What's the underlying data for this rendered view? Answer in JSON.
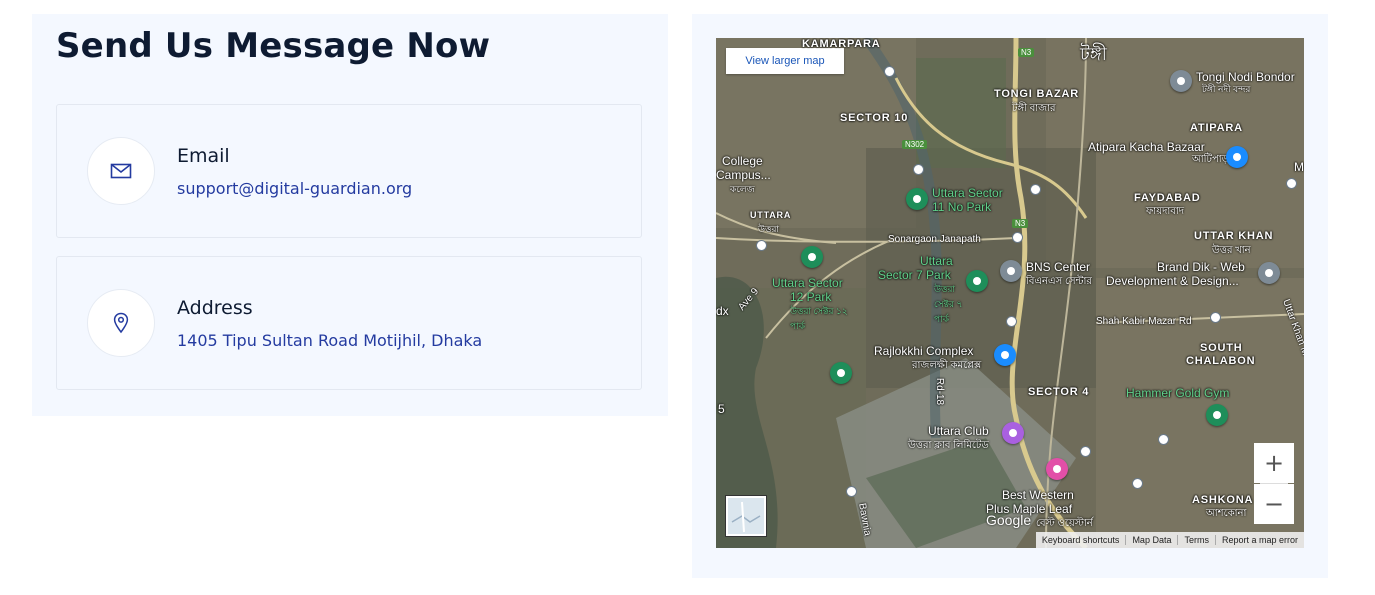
{
  "contact": {
    "heading": "Send Us Message Now",
    "email": {
      "title": "Email",
      "value": "support@digital-guardian.org",
      "icon": "envelope-icon"
    },
    "address": {
      "title": "Address",
      "value": "1405 Tipu Sultan Road Motijhil, Dhaka",
      "icon": "location-pin-icon"
    }
  },
  "map": {
    "view_larger": "View larger map",
    "zoom_in": "+",
    "zoom_out": "−",
    "google": "Google",
    "footer": {
      "shortcuts": "Keyboard shortcuts",
      "map_data": "Map Data",
      "terms": "Terms",
      "report": "Report a map error"
    },
    "labels": {
      "kamarpara": "KAMARPARA",
      "tongi_bn": "টঙ্গী",
      "tongi_nodi": "Tongi Nodi Bondor",
      "tongi_nodi_bn": "টঙ্গী নদী বন্দর",
      "tongi_bazar": "TONGI BAZAR",
      "tongi_bazar_bn": "টঙ্গী বাজার",
      "sector10": "SECTOR 10",
      "atipara": "ATIPARA",
      "atipara_kacha": "Atipara Kacha Bazaar",
      "atipara_kacha_bn": "আটিপাড়া",
      "college": "College",
      "campus": "Campus...",
      "college_bn": "কলেজ",
      "faydabad": "FAYDABAD",
      "faydabad_bn": "ফায়দাবাদ",
      "sector11_a": "Uttara Sector",
      "sector11_b": "11 No Park",
      "uttara": "UTTARA",
      "uttara_bn": "উত্তরা",
      "uttar_khan": "UTTAR KHAN",
      "uttar_khan_bn": "উত্তর খান",
      "sonargaon": "Sonargaon Janapath",
      "bns": "BNS Center",
      "bns_bn": "বিএনএস সেন্টার",
      "brand_a": "Brand Dik - Web",
      "brand_b": "Development & Design...",
      "sector7_a": "Uttara",
      "sector7_b": "Sector 7 Park",
      "sector7_bn": "উত্তরা সেক্টর ৭ পার্ক",
      "sector12_a": "Uttara Sector",
      "sector12_b": "12 Park",
      "sector12_bn": "উত্তরা সেক্টর ১২ পার্ক",
      "ave9": "Ave 9",
      "dx": "dx",
      "shah_kabir": "Shah Kabir Mazar Rd",
      "uttar_khan_rd": "Uttar Khan M",
      "south_chalabon_a": "SOUTH",
      "south_chalabon_b": "CHALABON",
      "rajlokkhi": "Rajlokkhi Complex",
      "rajlokkhi_bn": "রাজলক্ষী কমপ্লেক্স",
      "rd18": "Rd-18",
      "sector4": "SECTOR 4",
      "hammer": "Hammer Gold Gym",
      "uttara_club": "Uttara Club",
      "uttara_club_bn": "উত্তরা ক্লাব লিমিটেড",
      "best_western_a": "Best Western",
      "best_western_b": "Plus Maple Leaf",
      "best_western_bn": "বেস্ট ওয়েস্টার্ন",
      "ashkona": "ASHKONA",
      "ashkona_bn": "আশকোনা",
      "bawnia": "Bawnia",
      "n3a": "N3",
      "n3b": "N3",
      "n302": "N302",
      "m": "M",
      "five": "5"
    }
  },
  "colors": {
    "accent_text": "#243ba0",
    "heading": "#0e1b32",
    "panel_bg": "#f4f8ff"
  }
}
